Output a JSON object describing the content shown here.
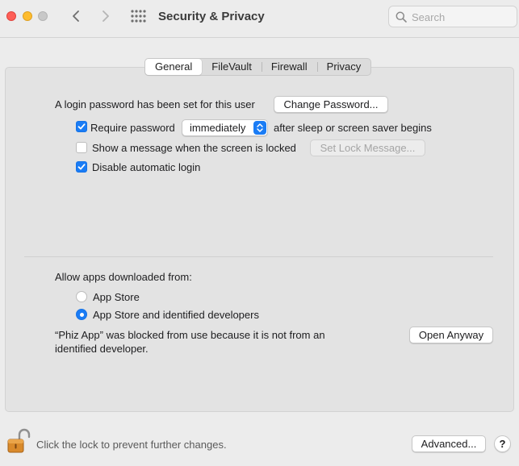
{
  "window": {
    "title": "Security & Privacy"
  },
  "search": {
    "placeholder": "Search",
    "value": ""
  },
  "tabs": [
    {
      "label": "General",
      "active": true
    },
    {
      "label": "FileVault",
      "active": false
    },
    {
      "label": "Firewall",
      "active": false
    },
    {
      "label": "Privacy",
      "active": false
    }
  ],
  "general": {
    "login_password_text": "A login password has been set for this user",
    "change_password_label": "Change Password...",
    "require_password": {
      "label": "Require password",
      "checked": true,
      "delay_value": "immediately",
      "suffix": "after sleep or screen saver begins"
    },
    "show_message": {
      "label": "Show a message when the screen is locked",
      "checked": false,
      "button_label": "Set Lock Message..."
    },
    "disable_auto_login": {
      "label": "Disable automatic login",
      "checked": true
    }
  },
  "apps": {
    "heading": "Allow apps downloaded from:",
    "options": [
      {
        "label": "App Store",
        "selected": false
      },
      {
        "label": "App Store and identified developers",
        "selected": true
      }
    ],
    "blocked_line1": "“Phiz App” was blocked from use because it is not from an",
    "blocked_line2": "identified developer.",
    "open_anyway_label": "Open Anyway"
  },
  "footer": {
    "lock_text": "Click the lock to prevent further changes.",
    "advanced_label": "Advanced...",
    "help_label": "?"
  },
  "colors": {
    "accent": "#1a7cf5",
    "close": "#fe5f57",
    "minimize": "#febc2e"
  },
  "icons": [
    "close-icon",
    "minimize-icon",
    "zoom-icon",
    "chevron-left-icon",
    "chevron-right-icon",
    "grid-icon",
    "search-icon",
    "lock-open-icon",
    "checkmark-icon",
    "help-icon"
  ]
}
